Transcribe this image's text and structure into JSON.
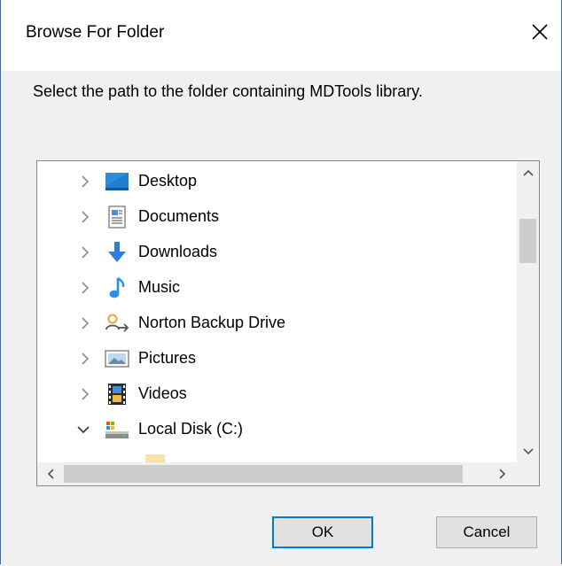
{
  "dialog": {
    "title": "Browse For Folder",
    "close_symbol": "✕",
    "instruction": "Select the path to the folder containing MDTools library."
  },
  "tree": {
    "items": [
      {
        "label": "Desktop",
        "icon": "desktop-icon",
        "expanded": false
      },
      {
        "label": "Documents",
        "icon": "documents-icon",
        "expanded": false
      },
      {
        "label": "Downloads",
        "icon": "downloads-icon",
        "expanded": false
      },
      {
        "label": "Music",
        "icon": "music-icon",
        "expanded": false
      },
      {
        "label": "Norton Backup Drive",
        "icon": "norton-backup-drive-icon",
        "expanded": false
      },
      {
        "label": "Pictures",
        "icon": "pictures-icon",
        "expanded": false
      },
      {
        "label": "Videos",
        "icon": "videos-icon",
        "expanded": false
      },
      {
        "label": "Local Disk (C:)",
        "icon": "local-disk-icon",
        "expanded": true
      }
    ]
  },
  "buttons": {
    "ok_label": "OK",
    "cancel_label": "Cancel"
  },
  "colors": {
    "accent": "#0078d7",
    "desktop_blue": "#1e7fd2",
    "music_blue": "#2a8fe6",
    "norton_orange": "#e8a33c",
    "scroll_thumb": "#cdcdcd"
  }
}
